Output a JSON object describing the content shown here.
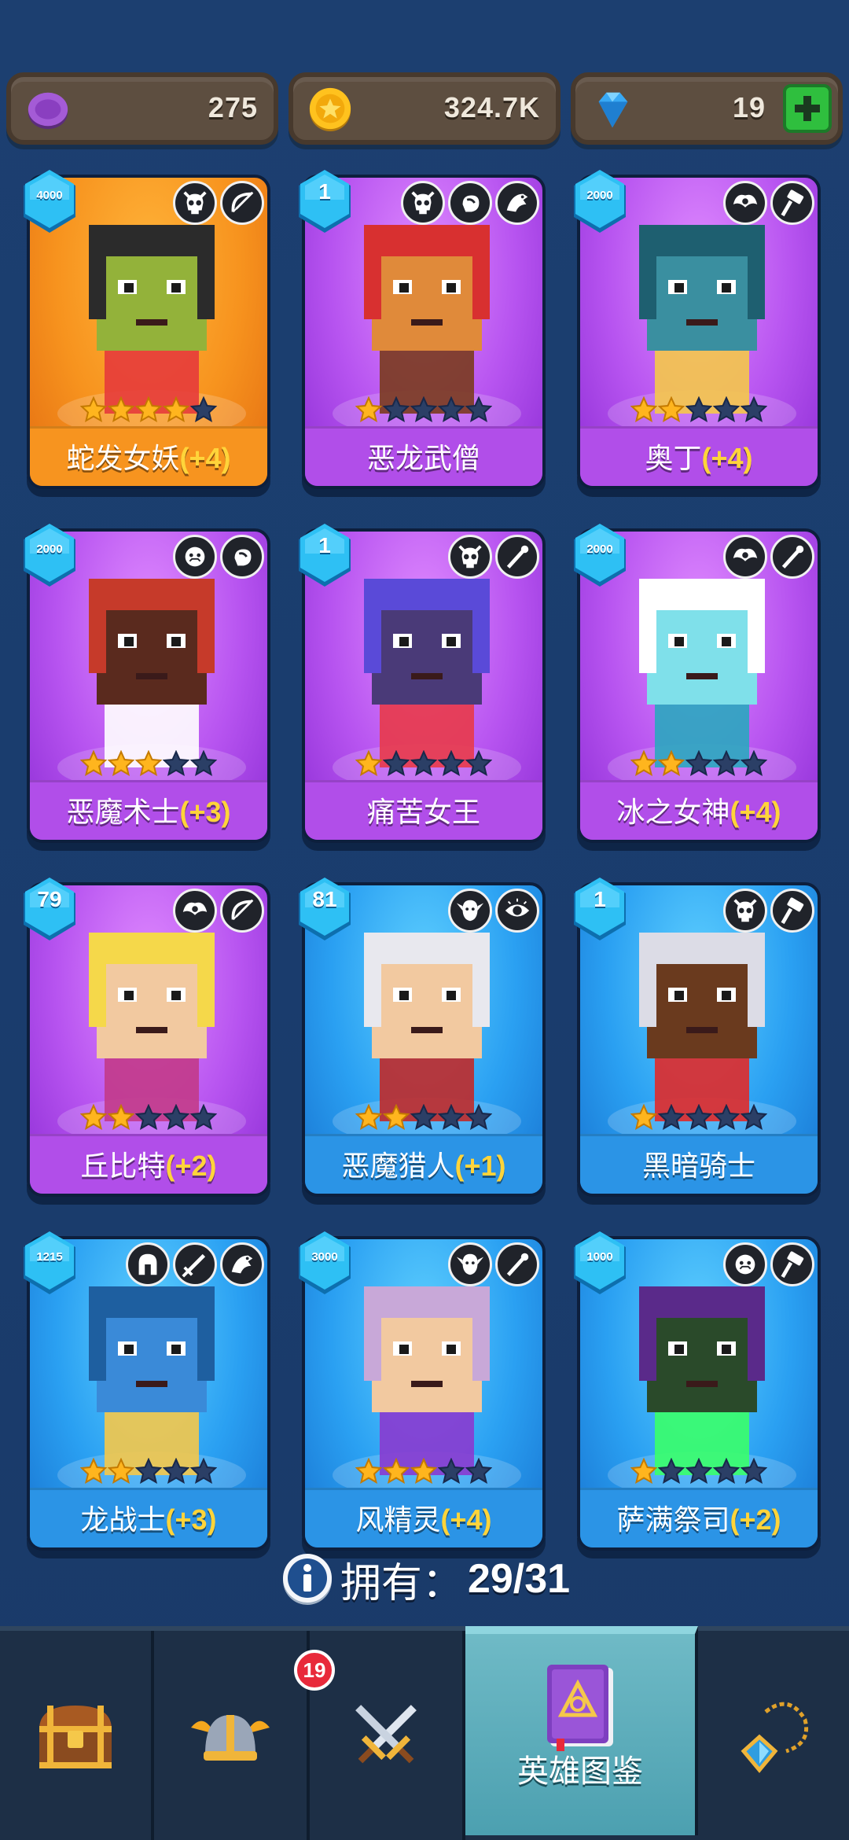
{
  "currency": {
    "potion": "275",
    "coins": "324.7K",
    "gems": "19"
  },
  "heroes": [
    {
      "name": "蛇发女妖",
      "bonus": "(+4)",
      "level": "4000",
      "stars": 4,
      "rarity": "orange",
      "traits": [
        "demon-skull-icon",
        "bow-icon"
      ]
    },
    {
      "name": "恶龙武僧",
      "bonus": "",
      "level": "1",
      "stars": 1,
      "rarity": "purple",
      "traits": [
        "demon-skull-icon",
        "fist-icon",
        "dragon-icon"
      ]
    },
    {
      "name": "奥丁",
      "bonus": "(+4)",
      "level": "2000",
      "stars": 2,
      "rarity": "purple",
      "traits": [
        "winged-emblem-icon",
        "hammer-icon"
      ]
    },
    {
      "name": "恶魔术士",
      "bonus": "(+3)",
      "level": "2000",
      "stars": 3,
      "rarity": "purple",
      "traits": [
        "orc-face-icon",
        "fist-icon"
      ]
    },
    {
      "name": "痛苦女王",
      "bonus": "",
      "level": "1",
      "stars": 1,
      "rarity": "purple",
      "traits": [
        "demon-skull-icon",
        "wand-icon"
      ]
    },
    {
      "name": "冰之女神",
      "bonus": "(+4)",
      "level": "2000",
      "stars": 2,
      "rarity": "purple",
      "traits": [
        "winged-emblem-icon",
        "wand-icon"
      ]
    },
    {
      "name": "丘比特",
      "bonus": "(+2)",
      "level": "79",
      "stars": 2,
      "rarity": "purple",
      "traits": [
        "winged-emblem-icon",
        "bow-icon"
      ]
    },
    {
      "name": "恶魔猎人",
      "bonus": "(+1)",
      "level": "81",
      "stars": 2,
      "rarity": "blue",
      "traits": [
        "elf-face-icon",
        "eye-icon"
      ]
    },
    {
      "name": "黑暗骑士",
      "bonus": "",
      "level": "1",
      "stars": 1,
      "rarity": "blue",
      "traits": [
        "demon-skull-icon",
        "hammer-icon"
      ]
    },
    {
      "name": "龙战士",
      "bonus": "(+3)",
      "level": "1215",
      "stars": 2,
      "rarity": "blue",
      "traits": [
        "helmet-icon",
        "sword-icon",
        "dragon-icon"
      ]
    },
    {
      "name": "风精灵",
      "bonus": "(+4)",
      "level": "3000",
      "stars": 3,
      "rarity": "blue",
      "traits": [
        "elf-face-icon",
        "wand-icon"
      ]
    },
    {
      "name": "萨满祭司",
      "bonus": "(+2)",
      "level": "1000",
      "stars": 1,
      "rarity": "blue",
      "traits": [
        "orc-face-icon",
        "hammer-icon"
      ]
    }
  ],
  "owned": {
    "label": "拥有：",
    "count": "29/31"
  },
  "nav": {
    "tabs": [
      {
        "icon": "treasure-chest-icon",
        "label": ""
      },
      {
        "icon": "viking-helmet-icon",
        "label": "",
        "badge": "19"
      },
      {
        "icon": "crossed-swords-icon",
        "label": ""
      },
      {
        "icon": "hero-book-icon",
        "label": "英雄图鉴",
        "active": true
      },
      {
        "icon": "amulet-icon",
        "label": ""
      }
    ]
  },
  "colors": {
    "background": "#1c3f70",
    "orange_card": "#f7931e",
    "purple_card": "#b754f0",
    "blue_card": "#2aa0f2",
    "bonus_text": "#ffd43a",
    "star_filled": "#ffb51e",
    "star_empty": "#2b3f66",
    "active_tab": "#5aaebc"
  }
}
